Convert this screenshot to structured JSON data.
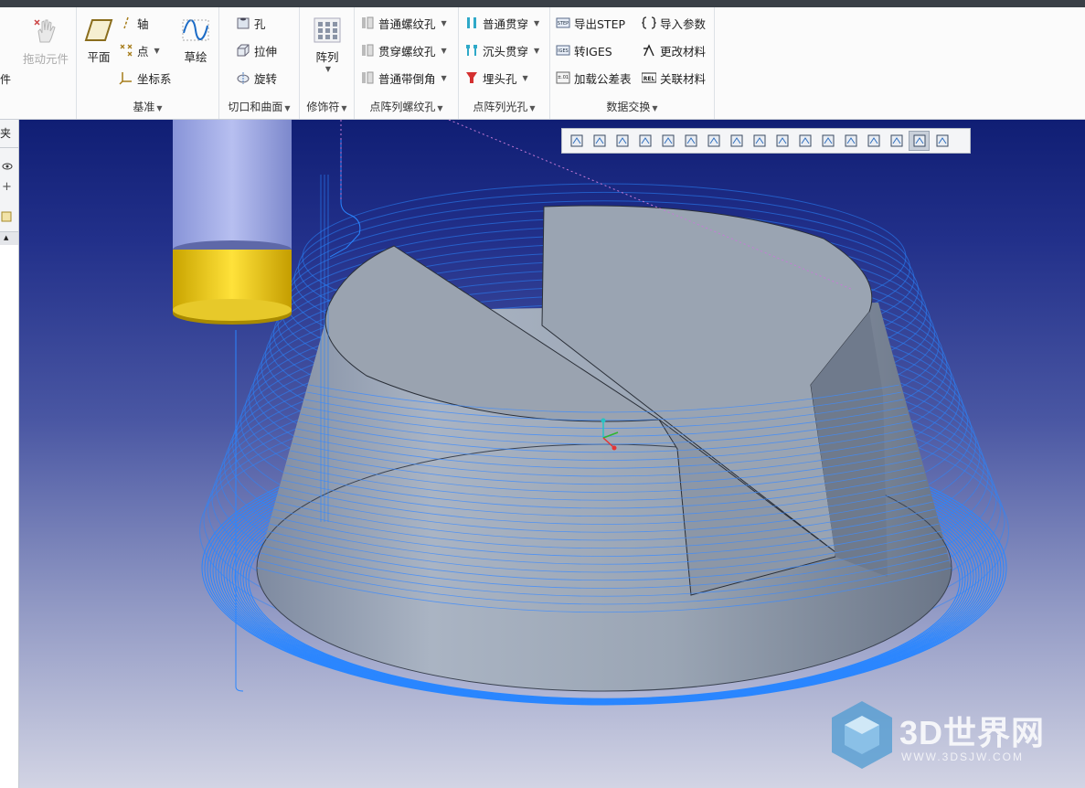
{
  "ribbon": {
    "drag": {
      "label": "拖动元件",
      "left_cut_label": "件"
    },
    "datum": {
      "title": "基准",
      "plane": "平面",
      "axis": "轴",
      "point": "点",
      "csys": "坐标系",
      "sketch": "草绘"
    },
    "cut": {
      "title": "切口和曲面",
      "hole": "孔",
      "extrude": "拉伸",
      "revolve": "旋转"
    },
    "decor": {
      "title": "修饰符",
      "pattern": "阵列"
    },
    "thread": {
      "title": "点阵列螺纹孔",
      "normal": "普通螺纹孔",
      "through": "贯穿螺纹孔",
      "chamfer": "普通带倒角"
    },
    "smooth": {
      "title": "点阵列光孔",
      "through": "普通贯穿",
      "counterbore": "沉头贯穿",
      "countersink": "埋头孔"
    },
    "data_exchange": {
      "title": "数据交换",
      "export_step": "导出STEP",
      "to_iges": "转IGES",
      "load_tol": "加载公差表",
      "import_param": "导入参数",
      "change_material": "更改材料",
      "link_material": "关联材料"
    }
  },
  "sidebar": {
    "tab_label": "夹"
  },
  "viewport": {
    "toolbar_icons": [
      "zoom-fit-icon",
      "zoom-in-icon",
      "zoom-out-icon",
      "repaint-icon",
      "shaded-icon",
      "view-manager-icon",
      "saved-views-icon",
      "perspective-icon",
      "datum-display-icon",
      "plane-display-icon",
      "axis-display-icon",
      "point-display-icon",
      "csys-display-icon",
      "annotation-display-icon",
      "spin-center-icon",
      "toolpath-display-icon",
      "more-icon"
    ],
    "active_tool": "toolpath-display-icon"
  },
  "watermark": {
    "brand": "3D世界网",
    "url": "WWW.3DSJW.COM"
  },
  "colors": {
    "toolpath": "#2a86ff",
    "part": "#9aa5b4",
    "tool_shank": "#9aa6e6",
    "tool_collar": "#f0c800"
  }
}
